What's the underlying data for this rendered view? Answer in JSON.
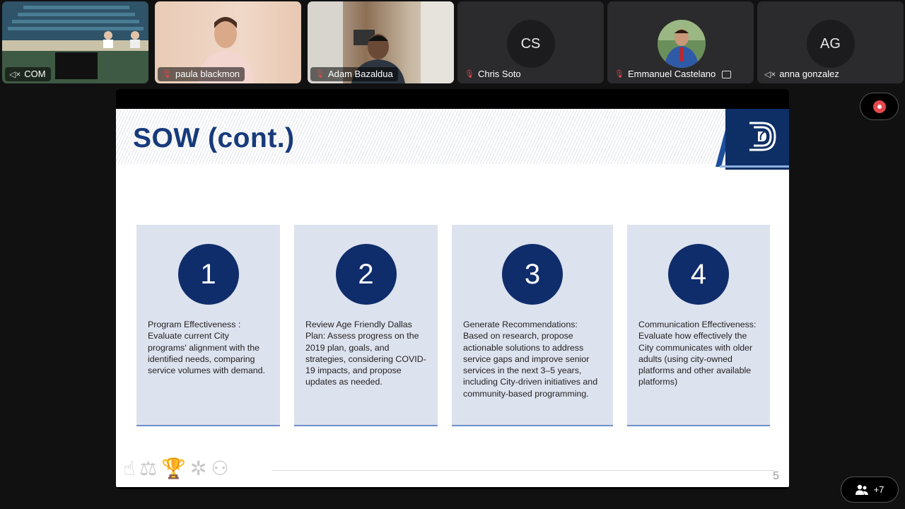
{
  "participants": [
    {
      "name": "COM",
      "initials": "",
      "muted": "speaker-off",
      "scene": "scene-com"
    },
    {
      "name": "paula blackmon",
      "initials": "",
      "muted": "mic-off",
      "scene": "scene-paula"
    },
    {
      "name": "Adam Bazaldua",
      "initials": "",
      "muted": "mic-off",
      "scene": "scene-adam"
    },
    {
      "name": "Chris Soto",
      "initials": "CS",
      "muted": "mic-off",
      "scene": "scene-dark"
    },
    {
      "name": "Emmanuel Castelano",
      "initials": "",
      "muted": "mic-off",
      "scene": "scene-dark"
    },
    {
      "name": "anna gonzalez",
      "initials": "AG",
      "muted": "speaker-off",
      "scene": "scene-dark"
    }
  ],
  "slide": {
    "title": "SOW (cont.)",
    "page_number": "5",
    "cards": [
      {
        "number": "1",
        "text": "Program Effectiveness : Evaluate current City programs' alignment with the identified needs, comparing service volumes with demand."
      },
      {
        "number": "2",
        "text": "Review Age Friendly Dallas Plan: Assess progress on the 2019 plan, goals, and strategies, considering COVID-19 impacts, and propose updates as needed."
      },
      {
        "number": "3",
        "text": "Generate Recommendations: Based on research, propose actionable solutions to address service gaps and improve senior services in the next 3–5 years, including City-driven initiatives and community-based programming."
      },
      {
        "number": "4",
        "text": "Communication Effectiveness: Evaluate how effectively the City communicates with older adults (using city-owned platforms and other available platforms)"
      }
    ]
  },
  "controls": {
    "participants_count": "+7"
  },
  "colors": {
    "slide_title": "#173a7a",
    "circle": "#0f2d6b",
    "card_bg": "#dde2ef",
    "record": "#e5484d"
  }
}
